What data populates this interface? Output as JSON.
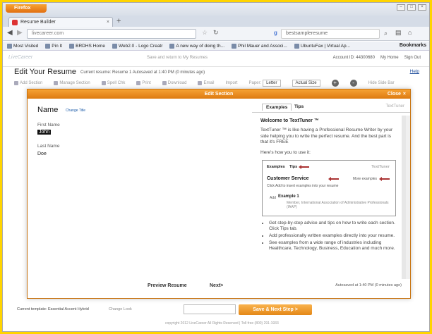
{
  "browser": {
    "menu_label": "Firefox",
    "tab_title": "Resume Builder",
    "url": "livecareer.com",
    "search_text": "bestsampleresume",
    "bookmarks": [
      "Most Visited",
      "Pin It",
      "BRDHS Home",
      "Web2.0 - Logo Creatr",
      "A new way of doing th...",
      "Phil Mauer and Associ...",
      "UbuntuFax | Virtual Ap...",
      "Bookmarks"
    ]
  },
  "site": {
    "logo": "LiveCareer",
    "message": "Save and return to My Resumes",
    "account": "Account ID: 44300680",
    "my_home": "My Home",
    "sign_out": "Sign Out"
  },
  "editor": {
    "title": "Edit Your Resume",
    "status": "Current resume: Resume 1   Autosaved at 1:40 PM (0 minutes ago)",
    "help": "Help",
    "toolbar": {
      "add_section": "Add Section",
      "manage_sections": "Manage Section",
      "spell_check": "Spell Chk",
      "print": "Print",
      "download": "Download",
      "email": "Email",
      "import": "Import",
      "paper_label": "Paper:",
      "paper_value": "Letter",
      "font_size": "Actual Size",
      "zoom_in": "+",
      "zoom_out": "-",
      "hide_tips": "Hide Side Bar"
    }
  },
  "modal": {
    "title": "Edit Section",
    "close_label": "Close",
    "close_glyph": "×",
    "section_name": "Name",
    "change_title": "Change Title",
    "first_name_label": "First Name",
    "first_name_value": "John",
    "last_name_label": "Last Name",
    "last_name_value": "Doe",
    "preview": "Preview Resume",
    "next": "Next>",
    "tabs": {
      "examples": "Examples",
      "tips": "Tips",
      "logo": "TextTuner"
    },
    "welcome_title": "Welcome to TextTuner ™",
    "welcome_body": "TextTuner ™ is like having a Professional Resume Writer by your side helping you to write the perfect resume. And the best part is that it's FREE",
    "howto": "Here's how you to use it:",
    "demo": {
      "tab_examples": "Examples",
      "tab_tips": "Tips",
      "tab_logo": "TextTuner",
      "section": "Customer Service",
      "click_text": "Click Add to insert examples into your resume",
      "more": "More examples",
      "example_label": "Example 1",
      "add_label": "Add",
      "example_desc": "Member, International Association of Administrative Professionals (IAAP)"
    },
    "bullets": [
      "Get step-by-step advice and tips on how to write each section. Click Tips tab.",
      "Add professionally written examples directly into your resume.",
      "See examples from a wide range of industries including Healthcare, Technology, Business, Education and much more."
    ],
    "autosave": "Autosaved at 1:40 PM (0 minutes ago)"
  },
  "footer": {
    "template": "Current template: Essential Accent Hybrid",
    "change": "Change Look",
    "next_step": "Save & Next Step >",
    "copyright": "copyright 2012 LiveCareer All Rights Reserved | Toll free (800) 291-1933"
  },
  "colors": {
    "accent": "#e8861a",
    "frame": "#ffd400"
  }
}
